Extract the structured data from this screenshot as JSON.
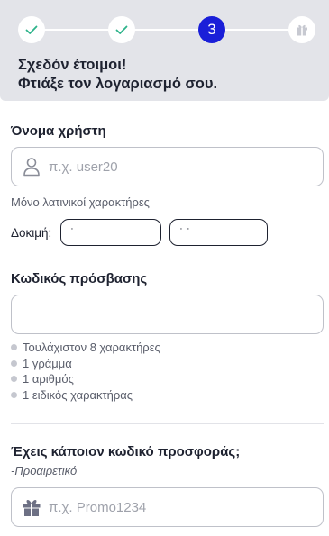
{
  "stepper": {
    "steps": [
      {
        "state": "completed",
        "icon": "check-icon"
      },
      {
        "state": "completed",
        "icon": "check-icon"
      },
      {
        "state": "current",
        "number": "3"
      },
      {
        "state": "upcoming",
        "icon": "gift-icon"
      }
    ],
    "accent_color": "#1a1fd8",
    "check_color": "#2db38a"
  },
  "header": {
    "title_line1": "Σχεδόν έτοιμοι!",
    "title_line2": "Φτιάξε τον λογαριασμό σου."
  },
  "username": {
    "label": "Όνομα χρήστη",
    "placeholder": "π.χ. user20",
    "value": "",
    "icon": "user-icon",
    "hint": "Μόνο λατινικοί χαρακτήρες",
    "suggestions_label": "Δοκιμή:",
    "suggestions": [
      "˙",
      "˙ ˙"
    ]
  },
  "password": {
    "label": "Κωδικός πρόσβασης",
    "value": "",
    "requirements": [
      "Τουλάχιστον 8 χαρακτήρες",
      "1 γράμμα",
      "1 αριθμός",
      "1 ειδικός χαρακτήρας"
    ]
  },
  "promo": {
    "label": "Έχεις κάποιον κωδικό προσφοράς;",
    "optional_note": "-Προαιρετικό",
    "placeholder": "π.χ. Promo1234",
    "value": "",
    "icon": "gift-icon"
  }
}
